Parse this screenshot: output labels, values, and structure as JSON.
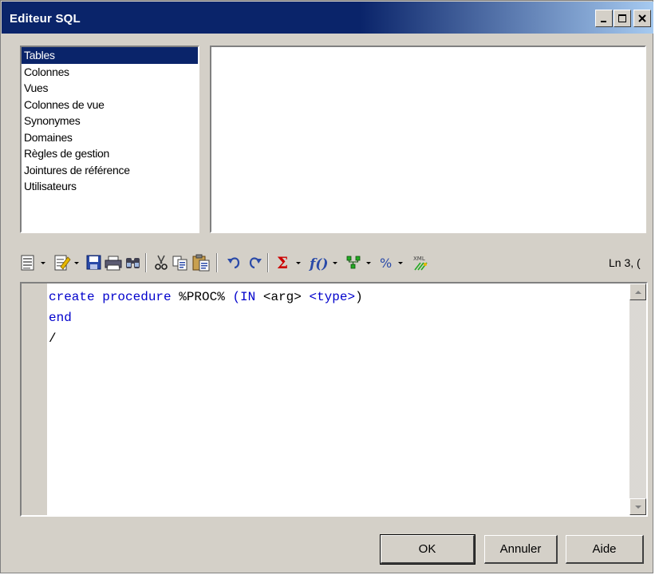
{
  "window": {
    "title": "Editeur SQL",
    "titlebar_colors": {
      "active_start": "#0a246a",
      "active_end": "#a6caf0"
    }
  },
  "object_list": {
    "selected_index": 0,
    "items": [
      {
        "label": "Tables"
      },
      {
        "label": "Colonnes"
      },
      {
        "label": "Vues"
      },
      {
        "label": "Colonnes de vue"
      },
      {
        "label": "Synonymes"
      },
      {
        "label": "Domaines"
      },
      {
        "label": "Règles de gestion"
      },
      {
        "label": "Jointures de référence"
      },
      {
        "label": "Utilisateurs"
      }
    ]
  },
  "toolbar": {
    "icons": [
      "editor-menu-icon",
      "edit-icon",
      "save-icon",
      "print-icon",
      "find-icon",
      "cut-icon",
      "copy-icon",
      "paste-icon",
      "undo-icon",
      "redo-icon",
      "sum-icon",
      "function-icon",
      "variables-icon",
      "macro-icon",
      "xml-icon"
    ],
    "status": "Ln 3, ("
  },
  "editor": {
    "lines": [
      [
        {
          "t": "create procedure",
          "k": true
        },
        {
          "t": " %PROC% ",
          "k": false
        },
        {
          "t": "(IN",
          "k": true
        },
        {
          "t": " <arg> ",
          "k": false
        },
        {
          "t": "<type>",
          "k": true
        },
        {
          "t": ")",
          "k": false
        }
      ],
      [
        {
          "t": "end",
          "k": true
        }
      ],
      [
        {
          "t": "/",
          "k": false
        }
      ]
    ],
    "keyword_color": "#0000cc"
  },
  "buttons": {
    "ok": "OK",
    "cancel": "Annuler",
    "help": "Aide"
  }
}
